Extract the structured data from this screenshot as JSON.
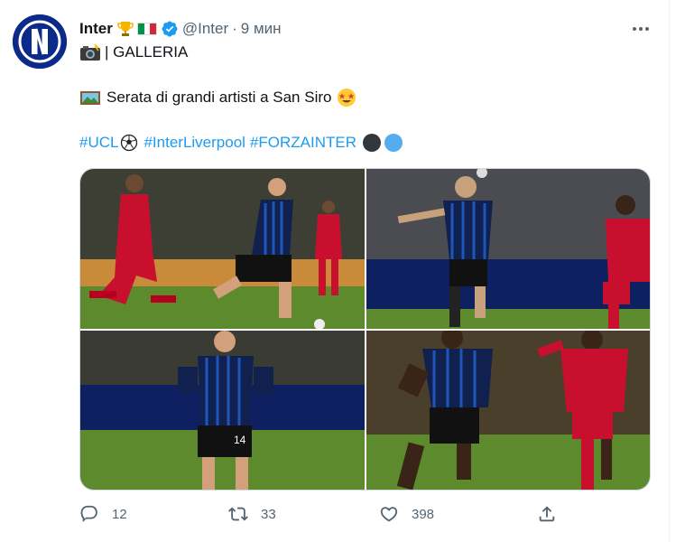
{
  "tweet": {
    "display_name": "Inter",
    "name_emojis": [
      "trophy-emoji",
      "italy-flag-emoji"
    ],
    "verified": true,
    "handle": "@Inter",
    "separator": "·",
    "time": "9 мин",
    "line1_text": "| GALLERIA",
    "line2_text": "Serata di grandi artisti a San Siro",
    "hashtags": {
      "ucl": "#UCL",
      "interliverpool": "#InterLiverpool",
      "forzainter": "#FORZAINTER"
    },
    "photos": [
      "photo-1",
      "photo-2",
      "photo-3",
      "photo-4"
    ]
  },
  "actions": {
    "replies": "12",
    "retweets": "33",
    "likes": "398"
  },
  "colors": {
    "link": "#1d9bf0",
    "muted": "#536471",
    "inter_blue": "#0b2a8a",
    "liverpool_red": "#c8102e"
  }
}
